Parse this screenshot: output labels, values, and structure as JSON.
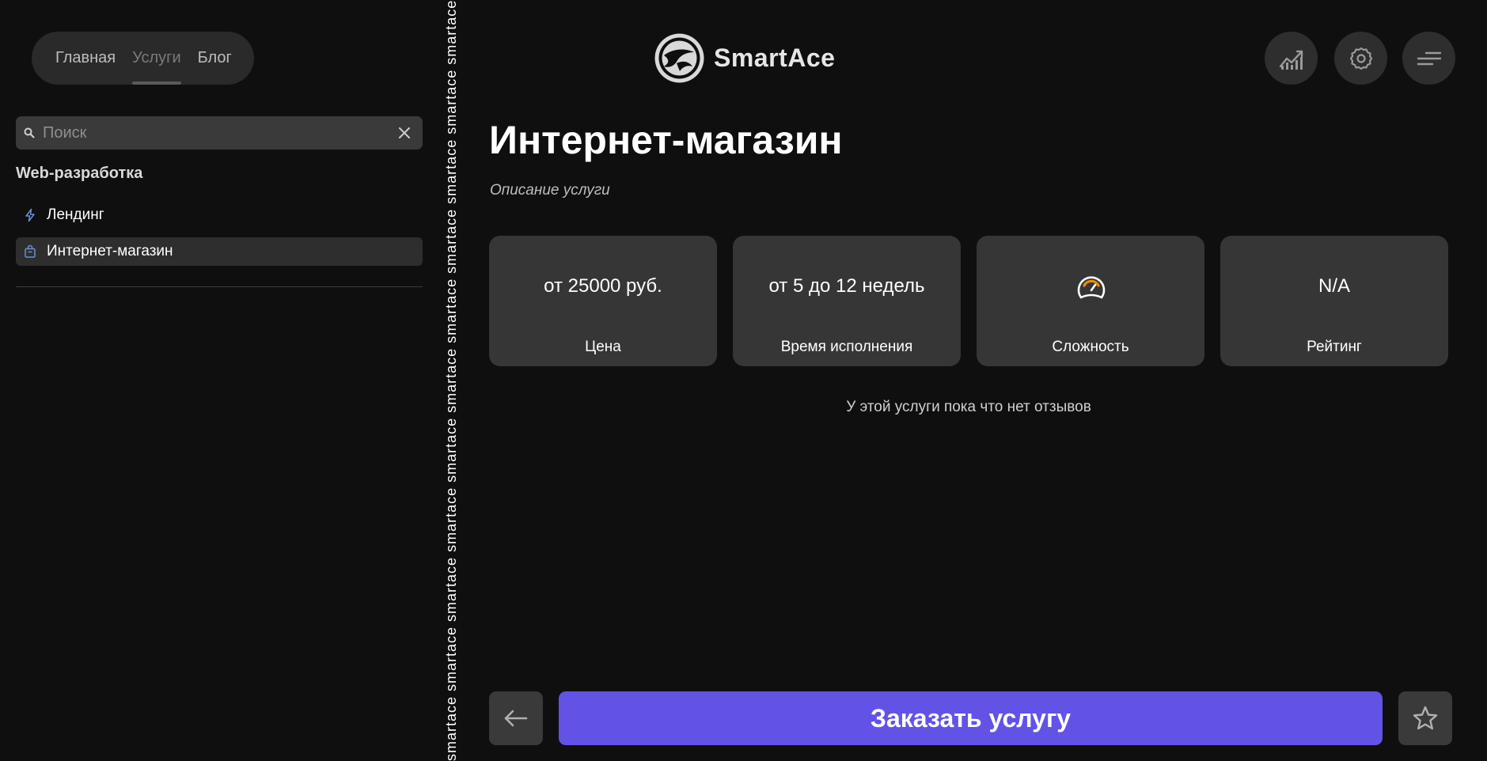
{
  "nav": {
    "items": [
      {
        "label": "Главная",
        "active": false
      },
      {
        "label": "Услуги",
        "active": true
      },
      {
        "label": "Блог",
        "active": false
      }
    ]
  },
  "search": {
    "placeholder": "Поиск",
    "value": ""
  },
  "sidebar": {
    "category_title": "Web-разработка",
    "items": [
      {
        "label": "Лендинг",
        "icon": "bolt-icon",
        "active": false
      },
      {
        "label": "Интернет-магазин",
        "icon": "shopping-bag-icon",
        "active": true
      }
    ]
  },
  "ticker": {
    "text": "smartace smartace smartace smartace smartace smartace smartace smartace smartace smartace smartace smartace smartace"
  },
  "header": {
    "logo_text": "SmartAce",
    "buttons": [
      {
        "name": "stats-button",
        "icon": "chart-icon"
      },
      {
        "name": "settings-button",
        "icon": "gear-icon"
      },
      {
        "name": "menu-button",
        "icon": "menu-icon"
      }
    ]
  },
  "service": {
    "title": "Интернет-магазин",
    "description": "Описание услуги",
    "cards": [
      {
        "value": "от 25000 руб.",
        "label": "Цена"
      },
      {
        "value": "от 5 до 12 недель",
        "label": "Время исполнения"
      },
      {
        "value": "",
        "label": "Сложность",
        "icon": "difficulty-gauge-icon"
      },
      {
        "value": "N/A",
        "label": "Рейтинг"
      }
    ],
    "no_reviews": "У этой услуги пока что нет отзывов"
  },
  "actions": {
    "order_label": "Заказать услугу",
    "back_icon": "arrow-left-icon",
    "favorite_icon": "star-icon"
  },
  "colors": {
    "background": "#0f0f0f",
    "surface": "#363636",
    "accent": "#6352e6",
    "gauge": "#f08a00",
    "sidebar_icon": "#6b8fd6"
  }
}
